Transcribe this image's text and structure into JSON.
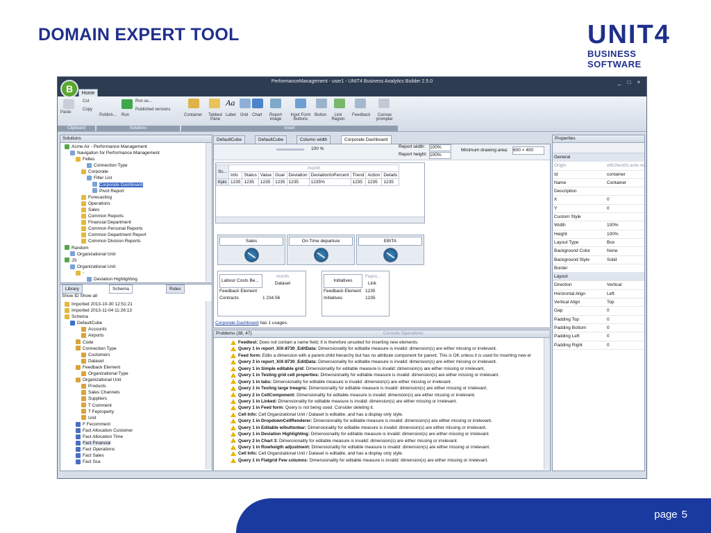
{
  "slide": {
    "title": "DOMAIN EXPERT TOOL",
    "logo_main": "UNIT4",
    "logo_sub": "BUSINESS SOFTWARE",
    "page_label": "page",
    "page_number": "5"
  },
  "app": {
    "window_title": "PerformanceManagement - user1 - UNIT4 Business Analytics Builder 2.5.0",
    "home_tab": "Home",
    "ribbon": {
      "paste": "Paste",
      "cut": "Cut",
      "copy": "Copy",
      "publish": "Publish...",
      "run": "Run",
      "run_as": "Run as...",
      "published_versions": "Published versions",
      "container": "Container",
      "tabbed_pane": "Tabbed Pane",
      "label": "Label",
      "grid": "Grid",
      "chart": "Chart",
      "report_image": "Report image",
      "input_form_buttons": "Input Form Buttons",
      "button": "Button",
      "link_region": "Link Region",
      "feedback": "Feedback",
      "canvas_prompter": "Canvas prompter",
      "groups": [
        "Clipboard",
        "Solutions",
        "Insert"
      ]
    },
    "solutions": {
      "header": "Solutions",
      "items": [
        "Acme Air - Performance Management",
        "Navigation for Performance Management",
        "Felles",
        "Connection Type",
        "Corporate",
        "Filter List",
        "Corporate Dashboard",
        "Pivot Report",
        "Forecasting",
        "Operations",
        "Sales",
        "Common Reports",
        "Financial Department",
        "Common Personal Reports",
        "Common Department Report",
        "Common Division Reports",
        "Random",
        "Organizational Unit",
        "JS",
        "Organizational Unit",
        "-",
        "Deviation Highlighting"
      ]
    },
    "lower_tabs": {
      "library": "Library",
      "schema": "Schema",
      "roles": "Roles"
    },
    "schema": {
      "show_id": "Show ID",
      "show_all": "Show all",
      "items": [
        "Imported 2013-10-30 12:51:21",
        "Imported 2013-11-04 11:26:13",
        "Schema",
        "DefaultCube",
        "Accounts",
        "Airports",
        "Code",
        "Connection Type",
        "Customers",
        "Dataset",
        "Feedback Element",
        "Organizational Type",
        "Organizational Unit",
        "Products",
        "Sales Channels",
        "Suppliers",
        "T Comment",
        "T Feproperty",
        "Unit",
        "F Fecomment",
        "Fact Allocation Customer",
        "Fact Allocation Time",
        "Fact Financial",
        "Fact Operations",
        "Fact Sales",
        "Fact Sca"
      ]
    },
    "doc_tabs": [
      "DefaultCube",
      "DefaultCube",
      "Column width",
      "Corporate Dashboard"
    ],
    "toolbar": {
      "zoom": "100 %",
      "report_width_label": "Report width:",
      "report_width": "100%",
      "report_height_label": "Report height:",
      "report_height": "100%",
      "min_draw_label": "Minimum drawing area:",
      "min_draw_value": "600 × 400"
    },
    "grid": {
      "corner": "Sc...",
      "month": "month",
      "headers": [
        "Info",
        "Status",
        "Value",
        "Goal",
        "Deviation",
        "DeviationInPercent",
        "Trend",
        "Action",
        "Details"
      ],
      "row_label": "Kpis",
      "row": [
        "1235",
        "1235",
        "1235",
        "1235",
        "1235",
        "1235%",
        "1235",
        "1235",
        "1235"
      ]
    },
    "kpis": [
      "Sales",
      "On-Time departure",
      "EBITA"
    ],
    "labour": {
      "title": "Labour Costs Be...",
      "month": "month",
      "dataset": "Dataset",
      "feedback": "Feedback Element",
      "contracts": "Contracts",
      "value": "1 234.56"
    },
    "initiatives": {
      "title": "Initiatives",
      "fepro": "Fepro...",
      "link": "Link",
      "feedback": "Feedback Element",
      "value1": "1235",
      "row": "Initiatives",
      "value2": "1235"
    },
    "usage": {
      "link": "Corporate Dashboard",
      "text": "has 1 usages."
    },
    "problems": {
      "header": "Problems (38, 47)",
      "console": "Console Operations",
      "items": [
        [
          "Feedtest:",
          " Does not contain a name field; It is therefore unsuited for inserting new elements."
        ],
        [
          "Query 1 in report_XIX-8730_EditData:",
          " Dimensionality for editable measure is invalid: dimension(s) are either missing or irrelevant."
        ],
        [
          "Feed form:",
          " Edits a dimension with a parent-child hierarchy but has no attribute component for parent. This is OK unless it is used for inserting new el"
        ],
        [
          "Query 3 in report_XIX-8730_EditData:",
          " Dimensionality for editable measure is invalid: dimension(s) are either missing or irrelevant."
        ],
        [
          "Query 1 in Simple editable grid:",
          " Dimensionality for editable measure is invalid: dimension(s) are either missing or irrelevant."
        ],
        [
          "Query 1 in Testing grid cell properties:",
          " Dimensionality for editable measure is invalid: dimension(s) are either missing or irrelevant."
        ],
        [
          "Query 1 in tabs:",
          " Dimensionality for editable measure is invalid: dimension(s) are either missing or irrelevant."
        ],
        [
          "Query 1 in Testing large treegris:",
          " Dimensionality for editable measure is invalid: dimension(s) are either missing or irrelevant."
        ],
        [
          "Query 2 in CellComponent:",
          " Dimensionality for editable measure is invalid: dimension(s) are either missing or irrelevant."
        ],
        [
          "Query 1 in Linked:",
          " Dimensionality for editable measure is invalid: dimension(s) are either missing or irrelevant."
        ],
        [
          "Query 1 in Feed form:",
          " Query is not being used. Consider deleting it."
        ],
        [
          "Cell Info:",
          " Cell Organizational Unit / Dataset is editable, and has a display only style."
        ],
        [
          "Query 1 in DropdownCellRenderer:",
          " Dimensionality for editable measure is invalid: dimension(s) are either missing or irrelevant."
        ],
        [
          "Query 1 in Editable w/buttonbar:",
          " Dimensionality for editable measure is invalid: dimension(s) are either missing or irrelevant."
        ],
        [
          "Query 1 in Deviation Highlighting:",
          " Dimensionality for editable measure is invalid: dimension(s) are either missing or irrelevant."
        ],
        [
          "Query 2 in Chart 3:",
          " Dimensionality for editable measure is invalid: dimension(s) are either missing or irrelevant."
        ],
        [
          "Query 1 in Rowheigth adjustment:",
          " Dimensionality for editable measure is invalid: dimension(s) are either missing or irrelevant."
        ],
        [
          "Cell Info:",
          " Cell Organizational Unit / Dataset is editable, and has a display only style."
        ],
        [
          "Query 1 in Flatgrid Few columns:",
          " Dimensionality for editable measure is invalid: dimension(s) are either missing or irrelevant."
        ]
      ]
    },
    "properties": {
      "header": "Properties",
      "rows": [
        [
          "cat",
          "General",
          ""
        ],
        [
          "row",
          "Origin",
          "w8r2test01.exie.no..."
        ],
        [
          "row",
          "Id",
          "container"
        ],
        [
          "row",
          "Name",
          "Container"
        ],
        [
          "row",
          "Description",
          ""
        ],
        [
          "row",
          "X",
          "0"
        ],
        [
          "row",
          "Y",
          "0"
        ],
        [
          "row",
          "Custom Style",
          ""
        ],
        [
          "row",
          "Width",
          "100%"
        ],
        [
          "row",
          "Height",
          "100%"
        ],
        [
          "row",
          "Layout Type",
          "Box"
        ],
        [
          "row",
          "Background Color",
          "None"
        ],
        [
          "row",
          "Background Style",
          "Solid"
        ],
        [
          "row",
          "Border",
          ""
        ],
        [
          "cat",
          "Layout",
          ""
        ],
        [
          "row",
          "Direction",
          "Vertical"
        ],
        [
          "row",
          "Horizontal Align",
          "Left"
        ],
        [
          "row",
          "Vertical Align",
          "Top"
        ],
        [
          "row",
          "Gap",
          "0"
        ],
        [
          "row",
          "Padding Top",
          "0"
        ],
        [
          "row",
          "Padding Bottom",
          "0"
        ],
        [
          "row",
          "Padding Left",
          "0"
        ],
        [
          "row",
          "Padding Right",
          "0"
        ]
      ]
    }
  }
}
